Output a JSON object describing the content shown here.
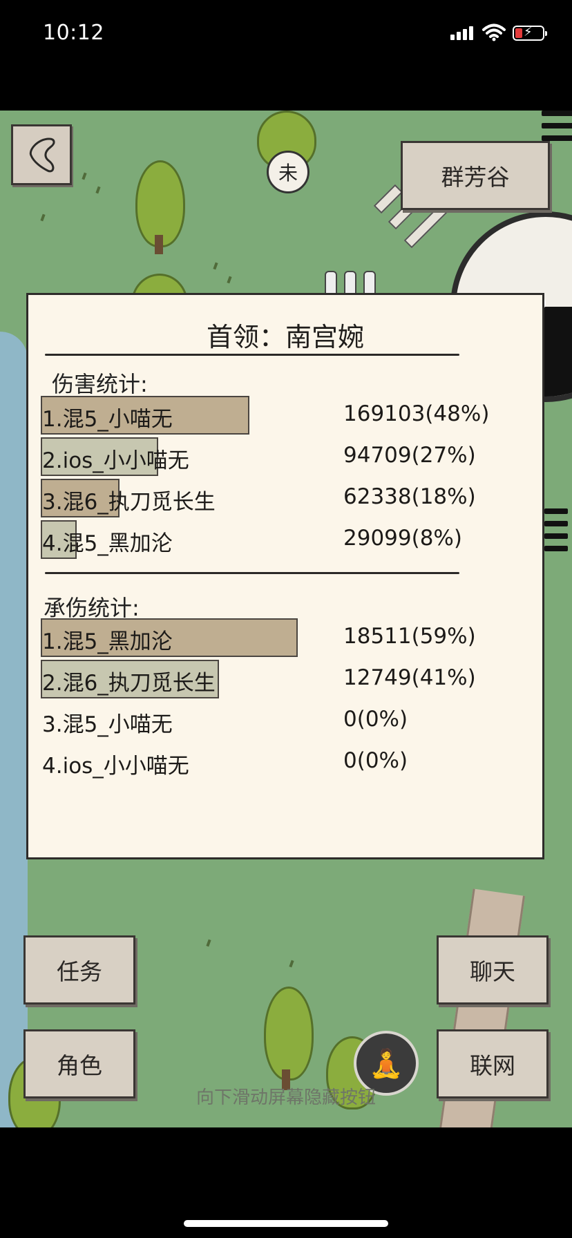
{
  "status_bar": {
    "time": "10:12"
  },
  "location": {
    "label": "群芳谷"
  },
  "marker": {
    "glyph": "未"
  },
  "boss_panel": {
    "title": "首领：南宫婉",
    "damage_section": {
      "title": "伤害统计:",
      "rows": [
        {
          "name": "1.混5_小喵无",
          "value": "169103(48%)",
          "percent": 48
        },
        {
          "name": "2.ios_小小喵无",
          "value": "94709(27%)",
          "percent": 27
        },
        {
          "name": "3.混6_执刀觅长生",
          "value": "62338(18%)",
          "percent": 18
        },
        {
          "name": "4.混5_黑加沦",
          "value": "29099(8%)",
          "percent": 8
        }
      ]
    },
    "taken_section": {
      "title": "承伤统计:",
      "rows": [
        {
          "name": "1.混5_黑加沦",
          "value": "18511(59%)",
          "percent": 59
        },
        {
          "name": "2.混6_执刀觅长生",
          "value": "12749(41%)",
          "percent": 41
        },
        {
          "name": "3.混5_小喵无",
          "value": "0(0%)",
          "percent": 0
        },
        {
          "name": "4.ios_小小喵无",
          "value": "0(0%)",
          "percent": 0
        }
      ]
    }
  },
  "buttons": {
    "quest": "任务",
    "character": "角色",
    "chat": "聊天",
    "online": "联网"
  },
  "hint": "向下滑动屏幕隐藏按钮",
  "icons": {
    "back": "back-arrow-icon",
    "meditate": "meditate-icon",
    "wifi": "wifi-icon",
    "battery": "battery-icon",
    "signal": "signal-icon"
  }
}
